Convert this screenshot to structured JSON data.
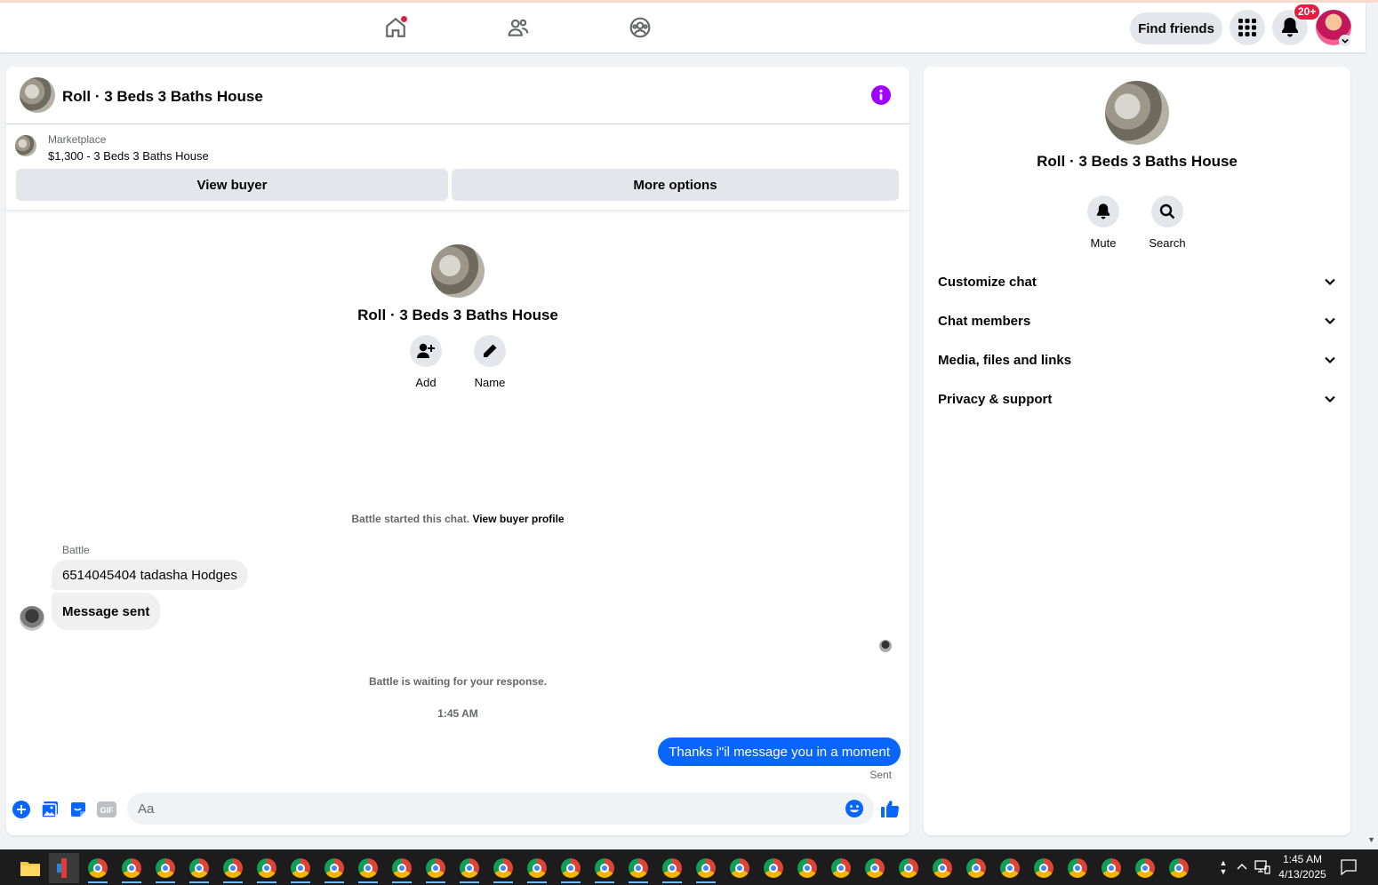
{
  "topbar": {
    "find_friends_label": "Find friends",
    "notification_count": "20+"
  },
  "chat": {
    "title": "Roll · 3 Beds 3 Baths House",
    "marketplace_label": "Marketplace",
    "listing": "$1,300 - 3 Beds 3 Baths House",
    "view_buyer_label": "View buyer",
    "more_options_label": "More options",
    "intro_name": "Roll · 3 Beds 3 Baths House",
    "add_label": "Add",
    "name_label": "Name",
    "started_text": "Battle started this chat.",
    "view_buyer_profile_label": "View buyer profile",
    "sender_name": "Battle",
    "messages_in": [
      "6514045404 tadasha Hodges",
      "Message sent"
    ],
    "waiting_text": "Battle is waiting for your response.",
    "time": "1:45 AM",
    "message_out": "Thanks i\"il message you in a moment",
    "sent_label": "Sent",
    "input_placeholder": "Aa"
  },
  "info": {
    "name": "Roll · 3 Beds 3 Baths House",
    "mute_label": "Mute",
    "search_label": "Search",
    "sections": [
      "Customize chat",
      "Chat members",
      "Media, files and links",
      "Privacy & support"
    ]
  },
  "taskbar": {
    "time": "1:45 AM",
    "date": "4/13/2025"
  },
  "colors": {
    "accent_blue": "#0866ff",
    "info_purple": "#a100ff",
    "badge_red": "#e41e3f"
  }
}
